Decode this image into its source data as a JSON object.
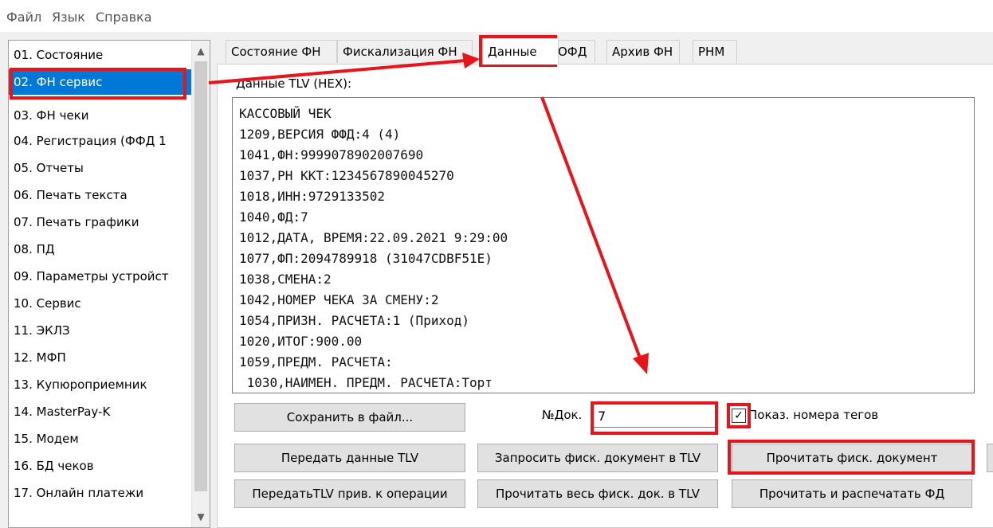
{
  "menu": [
    "Файл",
    "Язык",
    "Справка"
  ],
  "sidebar": {
    "items": [
      "01. Состояние",
      "02. ФН сервис",
      "03. ФН чеки",
      "04. Регистрация (ФФД 1",
      "05. Отчеты",
      "06. Печать текста",
      "07. Печать графики",
      "08. ПД",
      "09. Параметры устройст",
      "10. Сервис",
      "11. ЭКЛЗ",
      "12. МФП",
      "13. Купюроприемник",
      "14. MasterPay-K",
      "15. Модем",
      "16. БД чеков",
      "17. Онлайн платежи"
    ],
    "selected_index": 1
  },
  "tabs": [
    "Состояние ФН",
    "Фискализация ФН",
    "Данные",
    "ОФД",
    "Архив ФН",
    "РНМ"
  ],
  "active_tab": "Данные",
  "tlv": {
    "label": "Данные TLV (HEX):",
    "lines": [
      "КАССОВЫЙ ЧЕК",
      "1209,ВЕРСИЯ ФФД:4 (4)",
      "1041,ФН:9999078902007690",
      "1037,РН ККТ:1234567890045270",
      "1018,ИНН:9729133502",
      "1040,ФД:7",
      "1012,ДАТА, ВРЕМЯ:22.09.2021 9:29:00",
      "1077,ФП:2094789918 (31047CDBF51E)",
      "1038,СМЕНА:2",
      "1042,НОМЕР ЧЕКА ЗА СМЕНУ:2",
      "1054,ПРИЗН. РАСЧЕТА:1 (Приход)",
      "1020,ИТОГ:900.00",
      "1059,ПРЕДМ. РАСЧЕТА:",
      " 1030,НАИМЕН. ПРЕДМ. РАСЧЕТА:Торт"
    ]
  },
  "buttons": {
    "save_file": "Сохранить в файл...",
    "send_tlv": "Передать данные TLV",
    "request_fd_tlv": "Запросить фиск. документ в TLV",
    "read_fd": "Прочитать фиск. документ",
    "send_tlv_op": "ПередатьTLV прив. к операции",
    "read_full_fd_tlv": "Прочитать весь фиск. док. в TLV",
    "read_print_fd": "Прочитать и распечатать ФД"
  },
  "doc_number": {
    "label": "№Док.",
    "value": "7"
  },
  "show_tag_numbers": {
    "label": "Показ. номера тегов",
    "checked": true,
    "mark": "✓"
  },
  "colors": {
    "highlight": "#e8141a",
    "selection": "#0078d7"
  }
}
